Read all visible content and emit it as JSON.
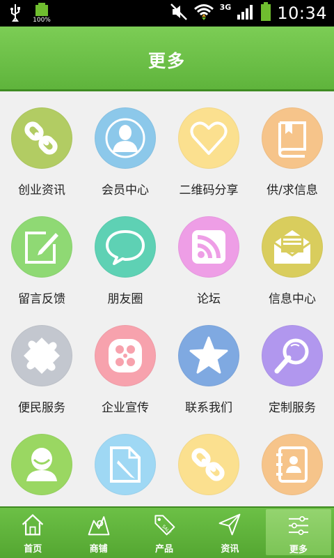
{
  "status": {
    "time": "10:34",
    "network": "3G",
    "battery_pct": "100%"
  },
  "title": "更多",
  "grid": [
    {
      "label": "创业资讯",
      "icon": "link-icon",
      "color": "#b2cc63"
    },
    {
      "label": "会员中心",
      "icon": "person-icon",
      "color": "#8cc8ea"
    },
    {
      "label": "二维码分享",
      "icon": "heart-icon",
      "color": "#fbe08f"
    },
    {
      "label": "供/求信息",
      "icon": "book-icon",
      "color": "#f6c48a"
    },
    {
      "label": "留言反馈",
      "icon": "note-edit-icon",
      "color": "#8fd974"
    },
    {
      "label": "朋友圈",
      "icon": "speech-bubble-icon",
      "color": "#5ed1b4"
    },
    {
      "label": "论坛",
      "icon": "rss-icon",
      "color": "#ee9ee6"
    },
    {
      "label": "信息中心",
      "icon": "mail-icon",
      "color": "#d9cd5d"
    },
    {
      "label": "便民服务",
      "icon": "puzzle-icon",
      "color": "#c3c7cf"
    },
    {
      "label": "企业宣传",
      "icon": "film-reel-icon",
      "color": "#f7a2ad"
    },
    {
      "label": "联系我们",
      "icon": "star-icon",
      "color": "#7fa9e1"
    },
    {
      "label": "定制服务",
      "icon": "search-icon",
      "color": "#b197ee"
    },
    {
      "label": "",
      "icon": "user-icon",
      "color": "#9ad762"
    },
    {
      "label": "",
      "icon": "document-edit-icon",
      "color": "#9fd8f4"
    },
    {
      "label": "",
      "icon": "link-icon",
      "color": "#fbe08f"
    },
    {
      "label": "",
      "icon": "contacts-book-icon",
      "color": "#f6c48a"
    }
  ],
  "tabs": [
    {
      "label": "首页",
      "icon": "home-icon"
    },
    {
      "label": "商铺",
      "icon": "shop-icon"
    },
    {
      "label": "产品",
      "icon": "sale-tag-icon"
    },
    {
      "label": "资讯",
      "icon": "send-icon"
    },
    {
      "label": "更多",
      "icon": "settings-sliders-icon",
      "active": true
    }
  ]
}
